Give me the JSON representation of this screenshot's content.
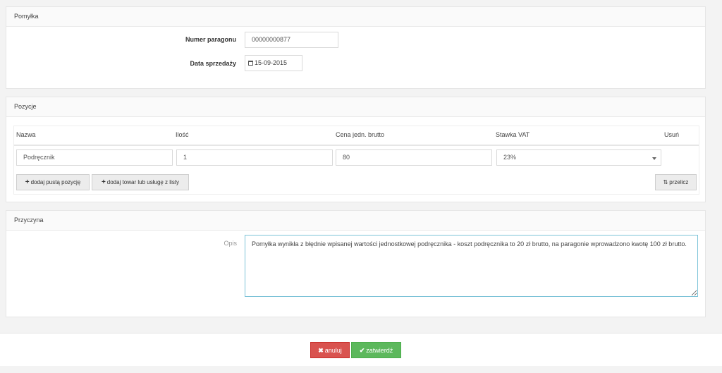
{
  "section_mistake": {
    "title": "Pomyłka",
    "receipt_label": "Numer paragonu",
    "receipt_value": "00000000877",
    "date_label": "Data sprzedaży",
    "date_value": "15-09-2015"
  },
  "section_items": {
    "title": "Pozycje",
    "columns": [
      "Nazwa",
      "Ilość",
      "Cena jedn. brutto",
      "Stawka VAT",
      "Usuń"
    ],
    "row": {
      "name": "Podręcznik",
      "qty": "1",
      "price": "80",
      "vat": "23%"
    },
    "add_empty_label": "dodaj pustą pozycję",
    "add_from_list_label": "dodaj towar lub usługę z listy",
    "recalc_label": "przelicz"
  },
  "section_reason": {
    "title": "Przyczyna",
    "desc_label": "Opis",
    "desc_value": "Pomyłka wynikła z błędnie wpisanej wartości jednostkowej podręcznika - koszt podręcznika to 20 zł brutto, na paragonie wprowadzono kwotę 100 zł brutto."
  },
  "footer": {
    "cancel_label": "anuluj",
    "confirm_label": "zatwierdź"
  },
  "icons": {
    "cancel": "x-icon",
    "confirm": "check-icon",
    "calendar": "calendar-icon",
    "add": "plus-icon",
    "recalc": "refresh-icon"
  },
  "colors": {
    "cancel_button": "#d9534f",
    "confirm_button": "#5cb85c",
    "textarea_focus_border": "#7cc3d8"
  }
}
